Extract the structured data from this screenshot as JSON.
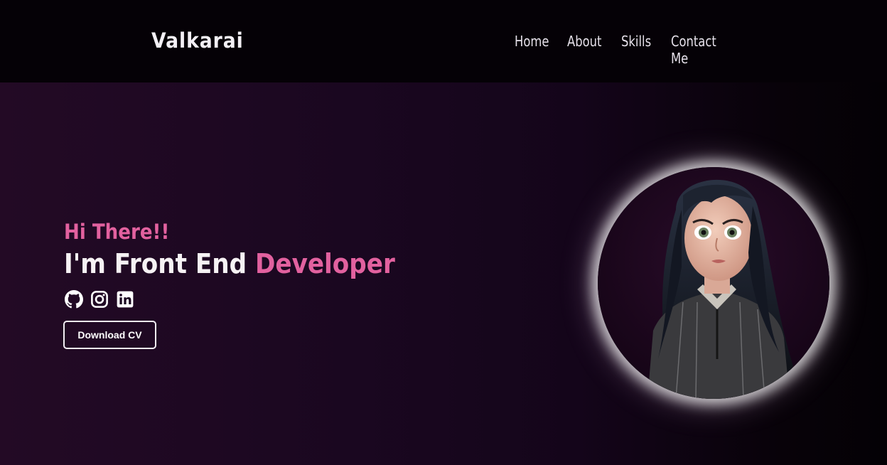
{
  "brand": {
    "name": "Valkarai"
  },
  "nav": {
    "items": [
      {
        "label": "Home"
      },
      {
        "label": "About"
      },
      {
        "label": "Skills"
      },
      {
        "label": "Contact Me"
      }
    ]
  },
  "hero": {
    "greeting": "Hi There!!",
    "headline_prefix": "I'm Front End ",
    "headline_accent": "Developer",
    "socials": [
      {
        "icon": "github-icon"
      },
      {
        "icon": "instagram-icon"
      },
      {
        "icon": "linkedin-icon"
      }
    ],
    "cta_label": "Download CV"
  },
  "colors": {
    "accent": "#e2619f",
    "background": "#050106",
    "hero_gradient_start": "#230a25",
    "text": "#f2eef4"
  }
}
